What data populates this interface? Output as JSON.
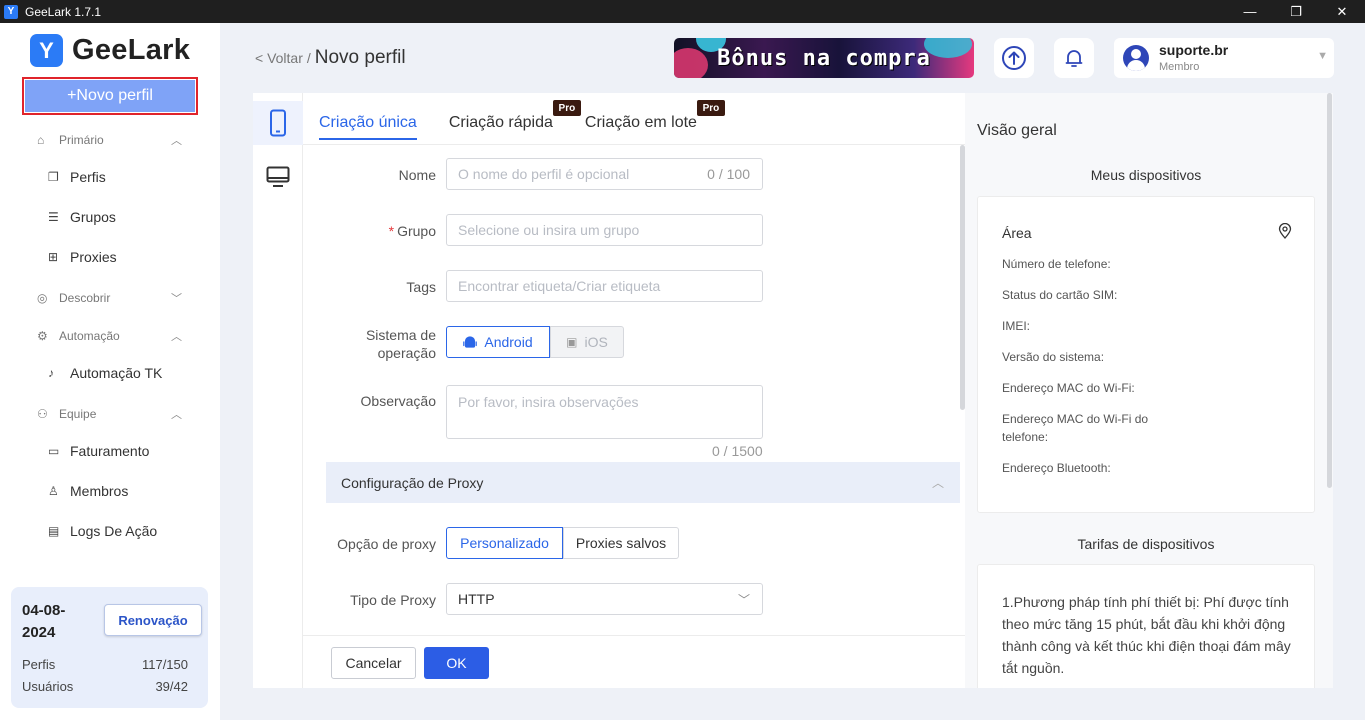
{
  "window": {
    "title": "GeeLark 1.7.1",
    "minimize": "—",
    "maximize": "❐",
    "close": "✕"
  },
  "sidebar": {
    "logo_text": "GeeLark",
    "new_profile_label": "+Novo perfil",
    "sections": [
      {
        "label": "Primário",
        "icon": "home-icon",
        "items": [
          {
            "label": "Perfis",
            "icon": "profile-icon"
          },
          {
            "label": "Grupos",
            "icon": "list-icon"
          },
          {
            "label": "Proxies",
            "icon": "network-icon"
          }
        ]
      },
      {
        "label": "Descobrir",
        "icon": "compass-icon",
        "items": []
      },
      {
        "label": "Automação",
        "icon": "automation-icon",
        "items": [
          {
            "label": "Automação TK",
            "icon": "tiktok-icon"
          }
        ]
      },
      {
        "label": "Equipe",
        "icon": "team-icon",
        "items": [
          {
            "label": "Faturamento",
            "icon": "billing-icon"
          },
          {
            "label": "Membros",
            "icon": "members-icon"
          },
          {
            "label": "Logs De Ação",
            "icon": "log-icon"
          }
        ]
      }
    ],
    "stats": {
      "date": "04-08-2024",
      "renew_label": "Renovação",
      "profiles_label": "Perfis",
      "profiles_value": "117/150",
      "users_label": "Usuários",
      "users_value": "39/42"
    }
  },
  "header": {
    "back_label": "< Voltar",
    "separator": "/",
    "title": "Novo perfil",
    "banner_text": "Bônus na compra",
    "user_name": "suporte.br",
    "user_role": "Membro"
  },
  "form": {
    "tabs": [
      {
        "label": "Criação única",
        "active": true
      },
      {
        "label": "Criação rápida",
        "pro": "Pro"
      },
      {
        "label": "Criação em lote",
        "pro": "Pro"
      }
    ],
    "name_label": "Nome",
    "name_placeholder": "O nome do perfil é opcional",
    "name_counter": "0 / 100",
    "group_required": "*",
    "group_label": "Grupo",
    "group_placeholder": "Selecione ou insira um grupo",
    "tags_label": "Tags",
    "tags_placeholder": "Encontrar etiqueta/Criar etiqueta",
    "os_label": "Sistema de operação",
    "os_android": "Android",
    "os_ios": "iOS",
    "notes_label": "Observação",
    "notes_placeholder": "Por favor, insira observações",
    "notes_counter": "0 / 1500",
    "proxy_section_title": "Configuração de Proxy",
    "proxy_option_label": "Opção de proxy",
    "proxy_custom": "Personalizado",
    "proxy_saved": "Proxies salvos",
    "proxy_type_label": "Tipo de Proxy",
    "proxy_type_value": "HTTP",
    "cancel_label": "Cancelar",
    "ok_label": "OK"
  },
  "overview": {
    "title": "Visão geral",
    "devices_title": "Meus dispositivos",
    "area_label": "Área",
    "fields": [
      "Número de telefone:",
      "Status do cartão SIM:",
      "IMEI:",
      "Versão do sistema:",
      "Endereço MAC do Wi-Fi:",
      "Endereço MAC do Wi-Fi do telefone:",
      "Endereço Bluetooth:"
    ],
    "rates_title": "Tarifas de dispositivos",
    "rates_text": "1.Phương pháp tính phí thiết bị: Phí được tính theo mức tăng 15 phút, bắt đầu khi khởi động thành công và kết thúc khi điện thoại đám mây tắt nguồn."
  },
  "colors": {
    "accent": "#2b66e8",
    "primary_button": "#2c5de5",
    "new_profile_bg": "#7fa3f7",
    "highlight_border": "#e0242b"
  }
}
